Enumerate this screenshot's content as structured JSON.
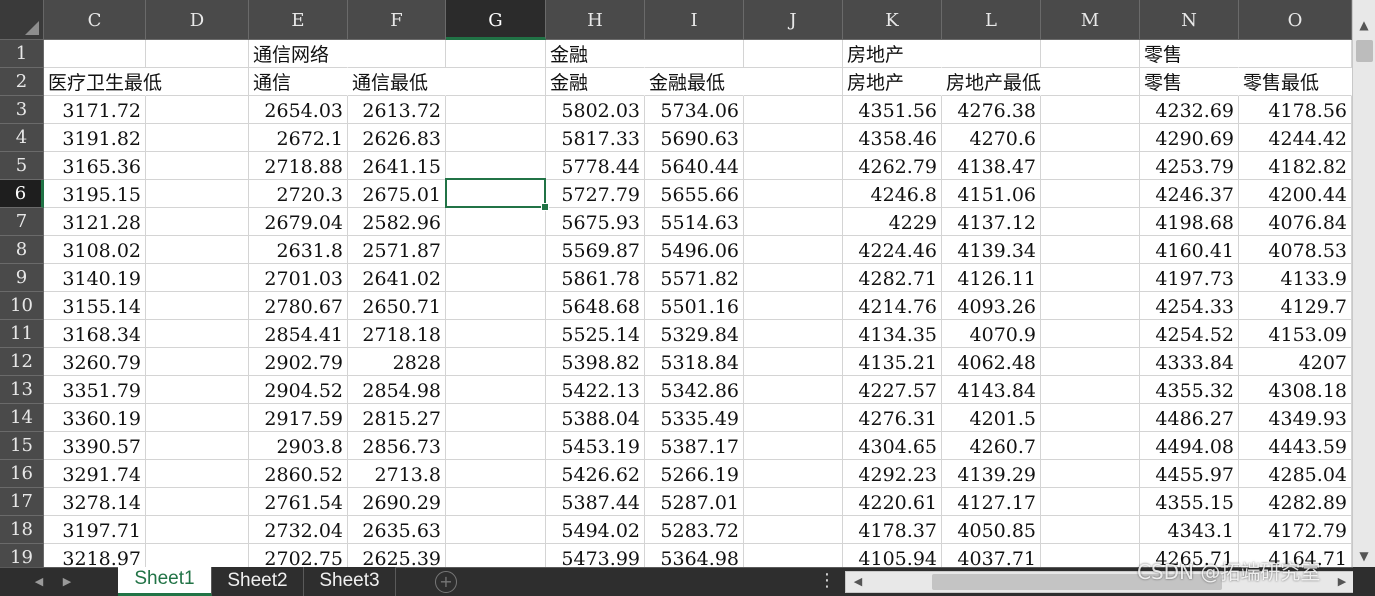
{
  "columns": [
    "C",
    "D",
    "E",
    "F",
    "G",
    "H",
    "I",
    "J",
    "K",
    "L",
    "M",
    "N",
    "O"
  ],
  "active_column": "G",
  "active_row": "6",
  "rows": [
    {
      "n": "1",
      "cells": {
        "E": "通信网络",
        "H": "金融",
        "K": "房地产",
        "N": "零售"
      }
    },
    {
      "n": "2",
      "cells": {
        "C": "医疗卫生最低",
        "E": "通信",
        "F": "通信最低",
        "H": "金融",
        "I": "金融最低",
        "K": "房地产",
        "L": "房地产最低",
        "N": "零售",
        "O": "零售最低"
      }
    },
    {
      "n": "3",
      "cells": {
        "C": "3171.72",
        "E": "2654.03",
        "F": "2613.72",
        "H": "5802.03",
        "I": "5734.06",
        "K": "4351.56",
        "L": "4276.38",
        "N": "4232.69",
        "O": "4178.56"
      }
    },
    {
      "n": "4",
      "cells": {
        "C": "3191.82",
        "E": "2672.1",
        "F": "2626.83",
        "H": "5817.33",
        "I": "5690.63",
        "K": "4358.46",
        "L": "4270.6",
        "N": "4290.69",
        "O": "4244.42"
      }
    },
    {
      "n": "5",
      "cells": {
        "C": "3165.36",
        "E": "2718.88",
        "F": "2641.15",
        "H": "5778.44",
        "I": "5640.44",
        "K": "4262.79",
        "L": "4138.47",
        "N": "4253.79",
        "O": "4182.82"
      }
    },
    {
      "n": "6",
      "cells": {
        "C": "3195.15",
        "E": "2720.3",
        "F": "2675.01",
        "H": "5727.79",
        "I": "5655.66",
        "K": "4246.8",
        "L": "4151.06",
        "N": "4246.37",
        "O": "4200.44"
      }
    },
    {
      "n": "7",
      "cells": {
        "C": "3121.28",
        "E": "2679.04",
        "F": "2582.96",
        "H": "5675.93",
        "I": "5514.63",
        "K": "4229",
        "L": "4137.12",
        "N": "4198.68",
        "O": "4076.84"
      }
    },
    {
      "n": "8",
      "cells": {
        "C": "3108.02",
        "E": "2631.8",
        "F": "2571.87",
        "H": "5569.87",
        "I": "5496.06",
        "K": "4224.46",
        "L": "4139.34",
        "N": "4160.41",
        "O": "4078.53"
      }
    },
    {
      "n": "9",
      "cells": {
        "C": "3140.19",
        "E": "2701.03",
        "F": "2641.02",
        "H": "5861.78",
        "I": "5571.82",
        "K": "4282.71",
        "L": "4126.11",
        "N": "4197.73",
        "O": "4133.9"
      }
    },
    {
      "n": "10",
      "cells": {
        "C": "3155.14",
        "E": "2780.67",
        "F": "2650.71",
        "H": "5648.68",
        "I": "5501.16",
        "K": "4214.76",
        "L": "4093.26",
        "N": "4254.33",
        "O": "4129.7"
      }
    },
    {
      "n": "11",
      "cells": {
        "C": "3168.34",
        "E": "2854.41",
        "F": "2718.18",
        "H": "5525.14",
        "I": "5329.84",
        "K": "4134.35",
        "L": "4070.9",
        "N": "4254.52",
        "O": "4153.09"
      }
    },
    {
      "n": "12",
      "cells": {
        "C": "3260.79",
        "E": "2902.79",
        "F": "2828",
        "H": "5398.82",
        "I": "5318.84",
        "K": "4135.21",
        "L": "4062.48",
        "N": "4333.84",
        "O": "4207"
      }
    },
    {
      "n": "13",
      "cells": {
        "C": "3351.79",
        "E": "2904.52",
        "F": "2854.98",
        "H": "5422.13",
        "I": "5342.86",
        "K": "4227.57",
        "L": "4143.84",
        "N": "4355.32",
        "O": "4308.18"
      }
    },
    {
      "n": "14",
      "cells": {
        "C": "3360.19",
        "E": "2917.59",
        "F": "2815.27",
        "H": "5388.04",
        "I": "5335.49",
        "K": "4276.31",
        "L": "4201.5",
        "N": "4486.27",
        "O": "4349.93"
      }
    },
    {
      "n": "15",
      "cells": {
        "C": "3390.57",
        "E": "2903.8",
        "F": "2856.73",
        "H": "5453.19",
        "I": "5387.17",
        "K": "4304.65",
        "L": "4260.7",
        "N": "4494.08",
        "O": "4443.59"
      }
    },
    {
      "n": "16",
      "cells": {
        "C": "3291.74",
        "E": "2860.52",
        "F": "2713.8",
        "H": "5426.62",
        "I": "5266.19",
        "K": "4292.23",
        "L": "4139.29",
        "N": "4455.97",
        "O": "4285.04"
      }
    },
    {
      "n": "17",
      "cells": {
        "C": "3278.14",
        "E": "2761.54",
        "F": "2690.29",
        "H": "5387.44",
        "I": "5287.01",
        "K": "4220.61",
        "L": "4127.17",
        "N": "4355.15",
        "O": "4282.89"
      }
    },
    {
      "n": "18",
      "cells": {
        "C": "3197.71",
        "E": "2732.04",
        "F": "2635.63",
        "H": "5494.02",
        "I": "5283.72",
        "K": "4178.37",
        "L": "4050.85",
        "N": "4343.1",
        "O": "4172.79"
      }
    },
    {
      "n": "19",
      "cells": {
        "C": "3218.97",
        "E": "2702.75",
        "F": "2625.39",
        "H": "5473.99",
        "I": "5364.98",
        "K": "4105.94",
        "L": "4037.71",
        "N": "4265.71",
        "O": "4164.71"
      }
    }
  ],
  "sheets": [
    "Sheet1",
    "Sheet2",
    "Sheet3"
  ],
  "active_sheet": "Sheet1",
  "watermark": "CSDN @拓端研究室",
  "icons": {
    "select_all": "triangle-corner-icon",
    "scroll_up": "▲",
    "scroll_down": "▼",
    "tab_prev": "◀",
    "tab_next": "▶",
    "add_sheet": "+",
    "more": "⋮",
    "hscroll_left": "◀",
    "hscroll_right": "▶"
  },
  "colors": {
    "accent": "#217346",
    "header_bg": "#4a4a4a",
    "grid": "#d4d4d4"
  }
}
